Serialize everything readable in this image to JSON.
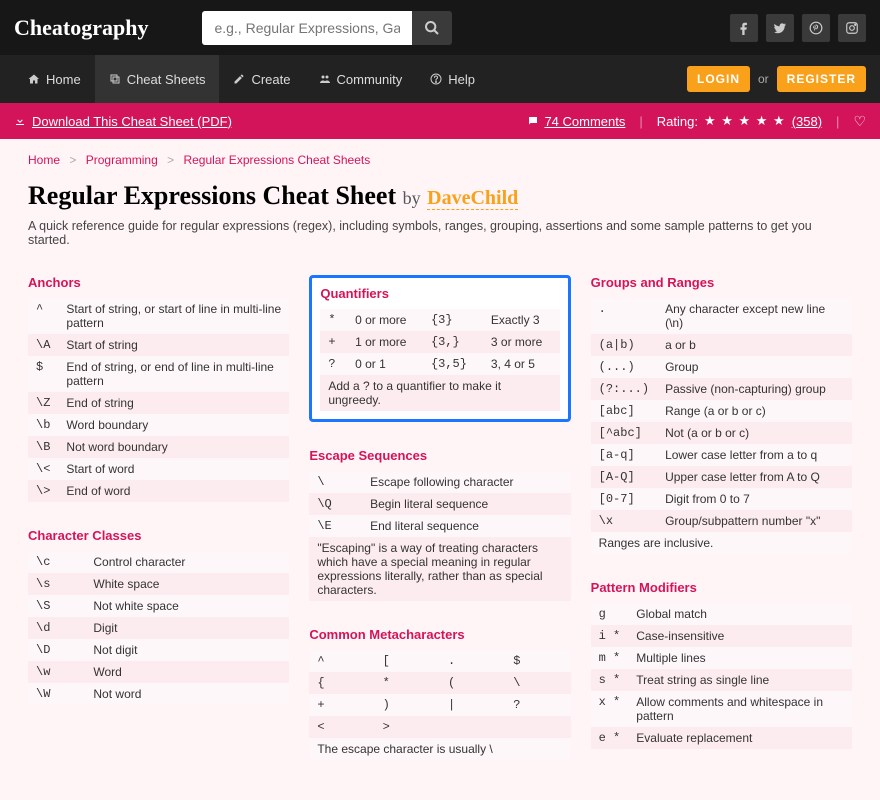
{
  "site": {
    "logo_text": "Cheatography"
  },
  "search": {
    "placeholder": "e.g., Regular Expressions, Garden, Kitchen, Audio"
  },
  "nav": {
    "home": "Home",
    "cheat_sheets": "Cheat Sheets",
    "create": "Create",
    "community": "Community",
    "help": "Help",
    "login": "LOGIN",
    "or": "or",
    "register": "REGISTER"
  },
  "dlbar": {
    "download_text": "Download This Cheat Sheet (PDF)",
    "comments_text": "74 Comments",
    "rating_label": "Rating:",
    "stars": "★ ★ ★ ★ ★",
    "rating_count": "(358)"
  },
  "breadcrumb": {
    "home": "Home",
    "programming": "Programming",
    "regex": "Regular Expressions Cheat Sheets"
  },
  "header": {
    "title": "Regular Expressions Cheat Sheet",
    "by": "by",
    "author": "DaveChild",
    "subtitle": "A quick reference guide for regular expressions (regex), including symbols, ranges, grouping, assertions and some sample patterns to get you started."
  },
  "anchors": {
    "title": "Anchors",
    "rows": [
      [
        "^",
        "Start of string, or start of line in multi-line pattern"
      ],
      [
        "\\A",
        "Start of string"
      ],
      [
        "$",
        "End of string, or end of line in multi-line pattern"
      ],
      [
        "\\Z",
        "End of string"
      ],
      [
        "\\b",
        "Word boundary"
      ],
      [
        "\\B",
        "Not word boundary"
      ],
      [
        "\\<",
        "Start of word"
      ],
      [
        "\\>",
        "End of word"
      ]
    ]
  },
  "charclasses": {
    "title": "Character Classes",
    "rows": [
      [
        "\\c",
        "Control character"
      ],
      [
        "\\s",
        "White space"
      ],
      [
        "\\S",
        "Not white space"
      ],
      [
        "\\d",
        "Digit"
      ],
      [
        "\\D",
        "Not digit"
      ],
      [
        "\\w",
        "Word"
      ],
      [
        "\\W",
        "Not word"
      ]
    ]
  },
  "quantifiers": {
    "title": "Quantifiers",
    "rows": [
      [
        "*",
        "0 or more",
        "{3}",
        "Exactly 3"
      ],
      [
        "+",
        "1 or more",
        "{3,}",
        "3 or more"
      ],
      [
        "?",
        "0 or 1",
        "{3,5}",
        "3, 4 or 5"
      ]
    ],
    "note": "Add a ? to a quantifier to make it ungreedy."
  },
  "escapes": {
    "title": "Escape Sequences",
    "rows": [
      [
        "\\",
        "Escape following character"
      ],
      [
        "\\Q",
        "Begin literal sequence"
      ],
      [
        "\\E",
        "End literal sequence"
      ]
    ],
    "note": "\"Escaping\" is a way of treating characters which have a special meaning in regular expressions literally, rather than as special characters."
  },
  "commonmeta": {
    "title": "Common Metacharacters",
    "rows": [
      [
        "^",
        "[",
        ".",
        "$"
      ],
      [
        "{",
        "*",
        "(",
        "\\"
      ],
      [
        "+",
        ")",
        "|",
        "?"
      ],
      [
        "<",
        ">",
        "",
        ""
      ]
    ],
    "note": "The escape character is usually \\"
  },
  "groups": {
    "title": "Groups and Ranges",
    "rows": [
      [
        ".",
        "Any character except new line (\\n)"
      ],
      [
        "(a|b)",
        "a or b"
      ],
      [
        "(...)",
        "Group"
      ],
      [
        "(?:...)",
        "Passive (non-capturing) group"
      ],
      [
        "[abc]",
        "Range (a or b or c)"
      ],
      [
        "[^abc]",
        "Not (a or b or c)"
      ],
      [
        "[a-q]",
        "Lower case letter from a to q"
      ],
      [
        "[A-Q]",
        "Upper case letter from A to Q"
      ],
      [
        "[0-7]",
        "Digit from 0 to 7"
      ],
      [
        "\\x",
        "Group/subpattern number \"x\""
      ]
    ],
    "note": "Ranges are inclusive."
  },
  "modifiers": {
    "title": "Pattern Modifiers",
    "rows": [
      [
        "g",
        "Global match"
      ],
      [
        "i *",
        "Case-insensitive"
      ],
      [
        "m *",
        "Multiple lines"
      ],
      [
        "s *",
        "Treat string as single line"
      ],
      [
        "x *",
        "Allow comments and whitespace in pattern"
      ],
      [
        "e *",
        "Evaluate replacement"
      ]
    ]
  }
}
